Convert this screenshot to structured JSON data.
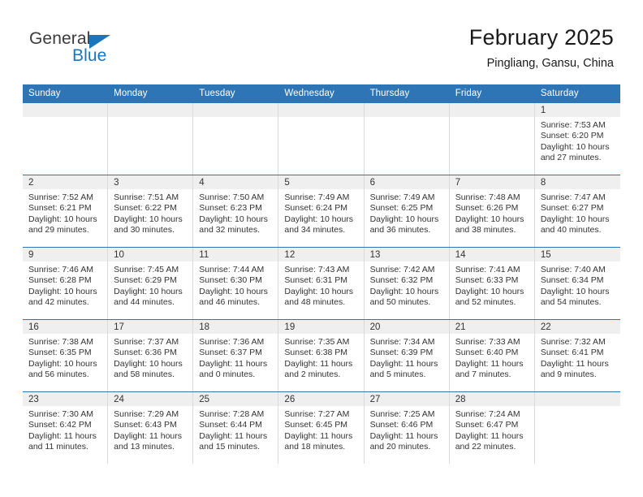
{
  "logo": {
    "word_top": "General",
    "word_bottom": "Blue",
    "accent_color": "#1b75bb",
    "triangle_icon": "triangle-icon"
  },
  "header": {
    "title": "February 2025",
    "location": "Pingliang, Gansu, China",
    "header_bg_color": "#2e75b6",
    "daynum_bg_color": "#efefef"
  },
  "weekday_headers": [
    "Sunday",
    "Monday",
    "Tuesday",
    "Wednesday",
    "Thursday",
    "Friday",
    "Saturday"
  ],
  "weeks": [
    [
      {
        "day": "",
        "sunrise": "",
        "sunset": "",
        "daylight_line1": "",
        "daylight_line2": ""
      },
      {
        "day": "",
        "sunrise": "",
        "sunset": "",
        "daylight_line1": "",
        "daylight_line2": ""
      },
      {
        "day": "",
        "sunrise": "",
        "sunset": "",
        "daylight_line1": "",
        "daylight_line2": ""
      },
      {
        "day": "",
        "sunrise": "",
        "sunset": "",
        "daylight_line1": "",
        "daylight_line2": ""
      },
      {
        "day": "",
        "sunrise": "",
        "sunset": "",
        "daylight_line1": "",
        "daylight_line2": ""
      },
      {
        "day": "",
        "sunrise": "",
        "sunset": "",
        "daylight_line1": "",
        "daylight_line2": ""
      },
      {
        "day": "1",
        "sunrise": "Sunrise: 7:53 AM",
        "sunset": "Sunset: 6:20 PM",
        "daylight_line1": "Daylight: 10 hours",
        "daylight_line2": "and 27 minutes."
      }
    ],
    [
      {
        "day": "2",
        "sunrise": "Sunrise: 7:52 AM",
        "sunset": "Sunset: 6:21 PM",
        "daylight_line1": "Daylight: 10 hours",
        "daylight_line2": "and 29 minutes."
      },
      {
        "day": "3",
        "sunrise": "Sunrise: 7:51 AM",
        "sunset": "Sunset: 6:22 PM",
        "daylight_line1": "Daylight: 10 hours",
        "daylight_line2": "and 30 minutes."
      },
      {
        "day": "4",
        "sunrise": "Sunrise: 7:50 AM",
        "sunset": "Sunset: 6:23 PM",
        "daylight_line1": "Daylight: 10 hours",
        "daylight_line2": "and 32 minutes."
      },
      {
        "day": "5",
        "sunrise": "Sunrise: 7:49 AM",
        "sunset": "Sunset: 6:24 PM",
        "daylight_line1": "Daylight: 10 hours",
        "daylight_line2": "and 34 minutes."
      },
      {
        "day": "6",
        "sunrise": "Sunrise: 7:49 AM",
        "sunset": "Sunset: 6:25 PM",
        "daylight_line1": "Daylight: 10 hours",
        "daylight_line2": "and 36 minutes."
      },
      {
        "day": "7",
        "sunrise": "Sunrise: 7:48 AM",
        "sunset": "Sunset: 6:26 PM",
        "daylight_line1": "Daylight: 10 hours",
        "daylight_line2": "and 38 minutes."
      },
      {
        "day": "8",
        "sunrise": "Sunrise: 7:47 AM",
        "sunset": "Sunset: 6:27 PM",
        "daylight_line1": "Daylight: 10 hours",
        "daylight_line2": "and 40 minutes."
      }
    ],
    [
      {
        "day": "9",
        "sunrise": "Sunrise: 7:46 AM",
        "sunset": "Sunset: 6:28 PM",
        "daylight_line1": "Daylight: 10 hours",
        "daylight_line2": "and 42 minutes."
      },
      {
        "day": "10",
        "sunrise": "Sunrise: 7:45 AM",
        "sunset": "Sunset: 6:29 PM",
        "daylight_line1": "Daylight: 10 hours",
        "daylight_line2": "and 44 minutes."
      },
      {
        "day": "11",
        "sunrise": "Sunrise: 7:44 AM",
        "sunset": "Sunset: 6:30 PM",
        "daylight_line1": "Daylight: 10 hours",
        "daylight_line2": "and 46 minutes."
      },
      {
        "day": "12",
        "sunrise": "Sunrise: 7:43 AM",
        "sunset": "Sunset: 6:31 PM",
        "daylight_line1": "Daylight: 10 hours",
        "daylight_line2": "and 48 minutes."
      },
      {
        "day": "13",
        "sunrise": "Sunrise: 7:42 AM",
        "sunset": "Sunset: 6:32 PM",
        "daylight_line1": "Daylight: 10 hours",
        "daylight_line2": "and 50 minutes."
      },
      {
        "day": "14",
        "sunrise": "Sunrise: 7:41 AM",
        "sunset": "Sunset: 6:33 PM",
        "daylight_line1": "Daylight: 10 hours",
        "daylight_line2": "and 52 minutes."
      },
      {
        "day": "15",
        "sunrise": "Sunrise: 7:40 AM",
        "sunset": "Sunset: 6:34 PM",
        "daylight_line1": "Daylight: 10 hours",
        "daylight_line2": "and 54 minutes."
      }
    ],
    [
      {
        "day": "16",
        "sunrise": "Sunrise: 7:38 AM",
        "sunset": "Sunset: 6:35 PM",
        "daylight_line1": "Daylight: 10 hours",
        "daylight_line2": "and 56 minutes."
      },
      {
        "day": "17",
        "sunrise": "Sunrise: 7:37 AM",
        "sunset": "Sunset: 6:36 PM",
        "daylight_line1": "Daylight: 10 hours",
        "daylight_line2": "and 58 minutes."
      },
      {
        "day": "18",
        "sunrise": "Sunrise: 7:36 AM",
        "sunset": "Sunset: 6:37 PM",
        "daylight_line1": "Daylight: 11 hours",
        "daylight_line2": "and 0 minutes."
      },
      {
        "day": "19",
        "sunrise": "Sunrise: 7:35 AM",
        "sunset": "Sunset: 6:38 PM",
        "daylight_line1": "Daylight: 11 hours",
        "daylight_line2": "and 2 minutes."
      },
      {
        "day": "20",
        "sunrise": "Sunrise: 7:34 AM",
        "sunset": "Sunset: 6:39 PM",
        "daylight_line1": "Daylight: 11 hours",
        "daylight_line2": "and 5 minutes."
      },
      {
        "day": "21",
        "sunrise": "Sunrise: 7:33 AM",
        "sunset": "Sunset: 6:40 PM",
        "daylight_line1": "Daylight: 11 hours",
        "daylight_line2": "and 7 minutes."
      },
      {
        "day": "22",
        "sunrise": "Sunrise: 7:32 AM",
        "sunset": "Sunset: 6:41 PM",
        "daylight_line1": "Daylight: 11 hours",
        "daylight_line2": "and 9 minutes."
      }
    ],
    [
      {
        "day": "23",
        "sunrise": "Sunrise: 7:30 AM",
        "sunset": "Sunset: 6:42 PM",
        "daylight_line1": "Daylight: 11 hours",
        "daylight_line2": "and 11 minutes."
      },
      {
        "day": "24",
        "sunrise": "Sunrise: 7:29 AM",
        "sunset": "Sunset: 6:43 PM",
        "daylight_line1": "Daylight: 11 hours",
        "daylight_line2": "and 13 minutes."
      },
      {
        "day": "25",
        "sunrise": "Sunrise: 7:28 AM",
        "sunset": "Sunset: 6:44 PM",
        "daylight_line1": "Daylight: 11 hours",
        "daylight_line2": "and 15 minutes."
      },
      {
        "day": "26",
        "sunrise": "Sunrise: 7:27 AM",
        "sunset": "Sunset: 6:45 PM",
        "daylight_line1": "Daylight: 11 hours",
        "daylight_line2": "and 18 minutes."
      },
      {
        "day": "27",
        "sunrise": "Sunrise: 7:25 AM",
        "sunset": "Sunset: 6:46 PM",
        "daylight_line1": "Daylight: 11 hours",
        "daylight_line2": "and 20 minutes."
      },
      {
        "day": "28",
        "sunrise": "Sunrise: 7:24 AM",
        "sunset": "Sunset: 6:47 PM",
        "daylight_line1": "Daylight: 11 hours",
        "daylight_line2": "and 22 minutes."
      },
      {
        "day": "",
        "sunrise": "",
        "sunset": "",
        "daylight_line1": "",
        "daylight_line2": ""
      }
    ]
  ]
}
